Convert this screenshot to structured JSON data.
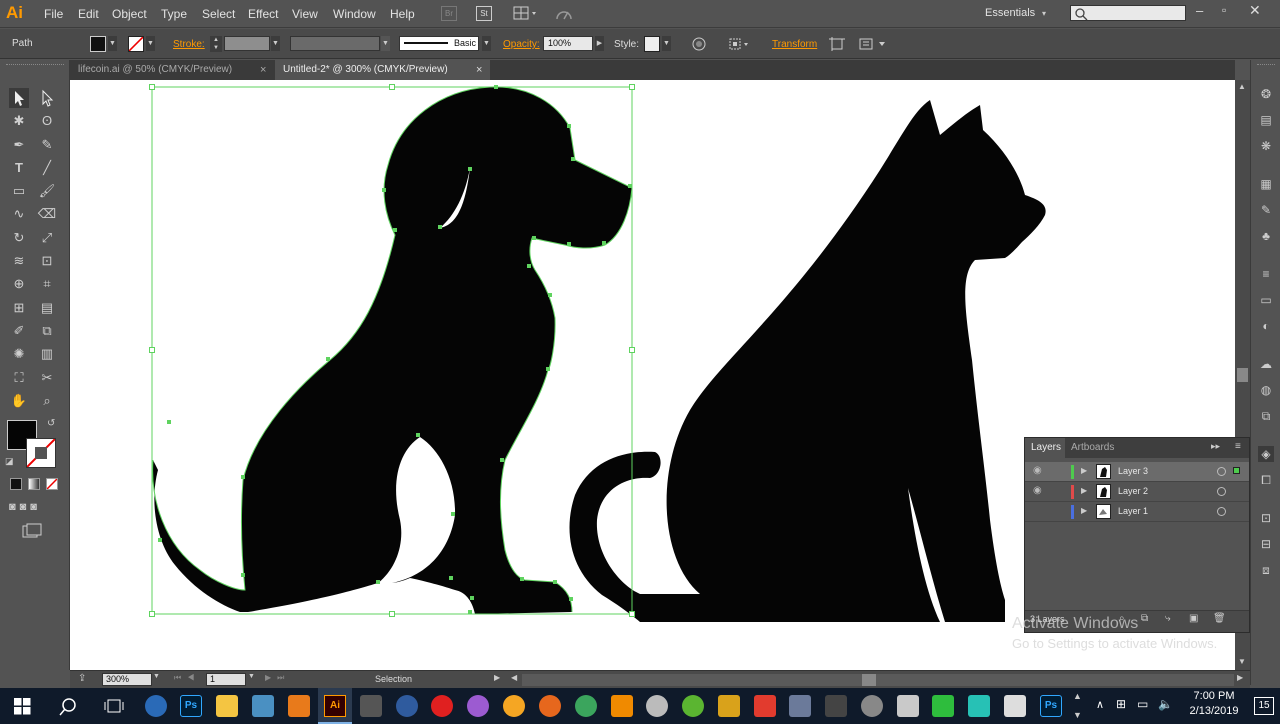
{
  "app": {
    "logo": "Ai"
  },
  "menu": [
    "File",
    "Edit",
    "Object",
    "Type",
    "Select",
    "Effect",
    "View",
    "Window",
    "Help"
  ],
  "menu_icons": {
    "bridge": "Br",
    "stock": "St"
  },
  "workspace": {
    "label": "Essentials"
  },
  "control": {
    "object_type": "Path",
    "stroke_label": "Stroke:",
    "brush_label": "Basic",
    "opacity_label": "Opacity:",
    "opacity_value": "100%",
    "style_label": "Style:",
    "transform_label": "Transform"
  },
  "tabs": [
    {
      "label": "lifecoin.ai @ 50% (CMYK/Preview)",
      "close": "×"
    },
    {
      "label": "Untitled-2* @ 300% (CMYK/Preview)",
      "close": "×"
    }
  ],
  "status": {
    "zoom": "300%",
    "artboard": "1",
    "tool": "Selection"
  },
  "layers_panel": {
    "tabs": [
      "Layers",
      "Artboards"
    ],
    "rows": [
      {
        "name": "Layer 3",
        "color": "#4ecb4e"
      },
      {
        "name": "Layer 2",
        "color": "#e04a4a"
      },
      {
        "name": "Layer 1",
        "color": "#4a6fe0"
      }
    ],
    "footer": "3 Layers"
  },
  "watermark": {
    "line1": "Activate Windows",
    "line2": "Go to Settings to activate Windows."
  },
  "taskbar": {
    "time": "7:00 PM",
    "date": "2/13/2019",
    "notifications": "15"
  },
  "colors": {
    "accent": "#ff9a00",
    "selection": "#5fd35f",
    "fill": "#050505"
  }
}
